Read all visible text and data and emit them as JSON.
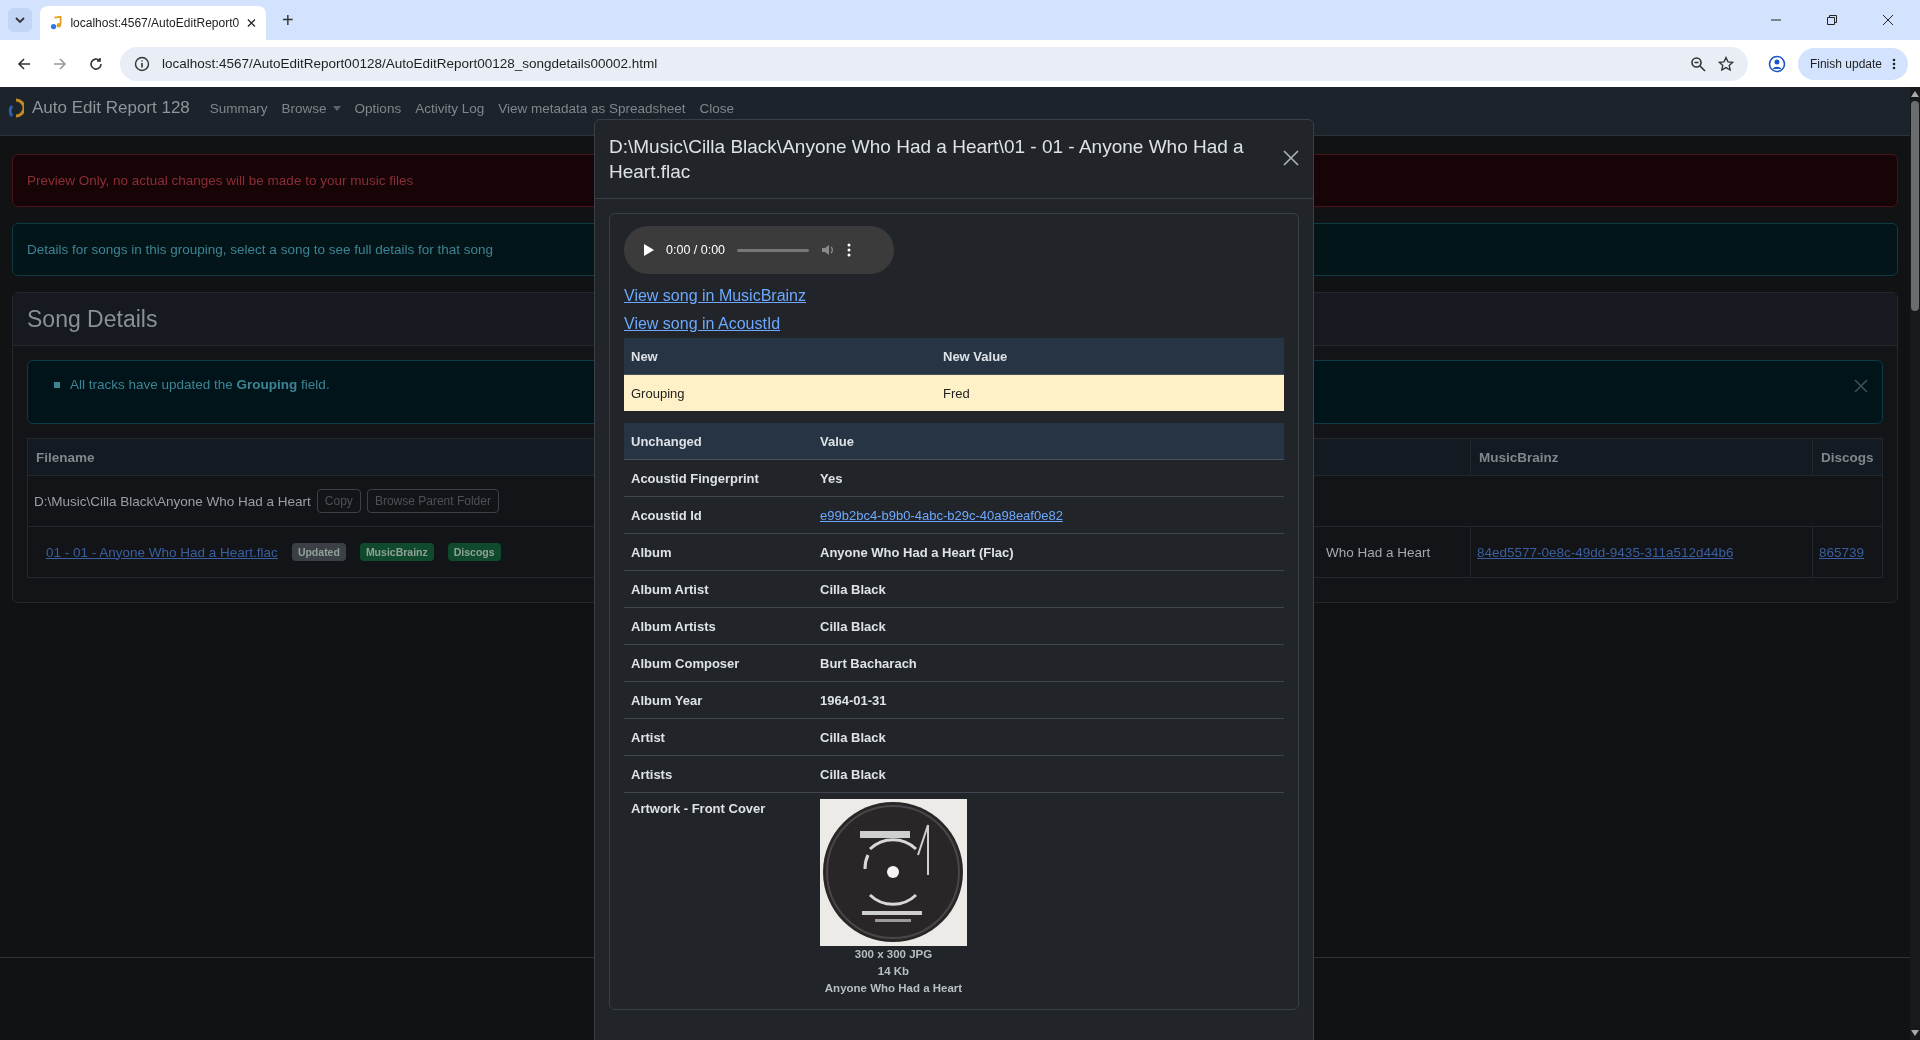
{
  "browser": {
    "tab_title": "localhost:4567/AutoEditReport0",
    "new_tab": "+",
    "url": "localhost:4567/AutoEditReport00128/AutoEditReport00128_songdetails00002.html",
    "update_button": "Finish update"
  },
  "navbar": {
    "brand": "Auto Edit Report 128",
    "items": [
      {
        "label": "Summary",
        "kind": "link"
      },
      {
        "label": "Browse",
        "kind": "dropdown"
      },
      {
        "label": "Options",
        "kind": "link"
      },
      {
        "label": "Activity Log",
        "kind": "link"
      },
      {
        "label": "View metadata as Spreadsheet",
        "kind": "link"
      },
      {
        "label": "Close",
        "kind": "link"
      }
    ]
  },
  "alerts": [
    {
      "kind": "danger",
      "text": "Preview Only, no actual changes will be made to your music files"
    },
    {
      "kind": "info",
      "text": "Details for songs in this grouping, select a song to see full details for that song"
    }
  ],
  "card": {
    "title": "Song Details",
    "notice": [
      "All tracks have updated the **Grouping** field."
    ],
    "table": {
      "columns": [
        "Filename",
        "MusicBrainz",
        "Discogs"
      ],
      "folder": {
        "path": "D:\\Music\\Cilla Black\\Anyone Who Had a Heart",
        "buttons": [
          "Copy",
          "Browse Parent Folder"
        ]
      },
      "song": {
        "file": "01 - 01 - Anyone Who Had a Heart.flac",
        "badges": [
          {
            "label": "Updated",
            "color": "#3c4046"
          },
          {
            "label": "MusicBrainz",
            "color": "#0f4a2c"
          },
          {
            "label": "Discogs",
            "color": "#0f4a2c"
          }
        ],
        "column_2": "Who Had a Heart",
        "musicbrainz": "84ed5577-0e8c-49dd-9435-311a512d44b6",
        "discogs": "865739"
      }
    }
  },
  "modal": {
    "title": "D:\\Music\\Cilla Black\\Anyone Who Had a Heart\\01 - 01 - Anyone Who Had a Heart.flac",
    "audio_time": "0:00 / 0:00",
    "links": [
      "View song in MusicBrainz",
      "View song in AcoustId"
    ],
    "new_table": {
      "columns": [
        "New",
        "New Value"
      ],
      "rows": [
        {
          "field": "Grouping",
          "value": "Fred"
        }
      ]
    },
    "unchanged_table": {
      "columns": [
        "Unchanged",
        "Value"
      ],
      "rows": [
        {
          "field": "Acoustid Fingerprint",
          "kind": "text",
          "value": "Yes"
        },
        {
          "field": "Acoustid Id",
          "kind": "link",
          "value": "e99b2bc4-b9b0-4abc-b29c-40a98eaf0e82"
        },
        {
          "field": "Album",
          "kind": "text",
          "value": "Anyone Who Had a Heart (Flac)"
        },
        {
          "field": "Album Artist",
          "kind": "text",
          "value": "Cilla Black"
        },
        {
          "field": "Album Artists",
          "kind": "text",
          "value": "Cilla Black"
        },
        {
          "field": "Album Composer",
          "kind": "text",
          "value": "Burt Bacharach"
        },
        {
          "field": "Album Year",
          "kind": "text",
          "value": "1964-01-31"
        },
        {
          "field": "Artist",
          "kind": "text",
          "value": "Cilla Black"
        },
        {
          "field": "Artists",
          "kind": "text",
          "value": "Cilla Black"
        },
        {
          "field": "Artwork - Front Cover",
          "kind": "artwork",
          "captions": [
            "300 x 300 JPG",
            "14 Kb",
            "Anyone Who Had a Heart"
          ]
        }
      ]
    }
  }
}
